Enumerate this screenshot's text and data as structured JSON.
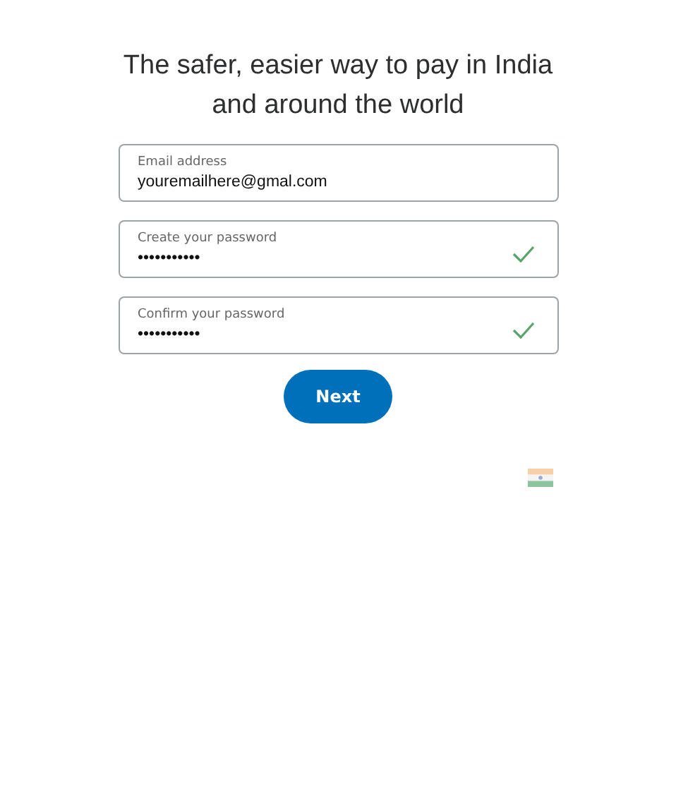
{
  "heading": "The safer, easier way to pay in India and around the world",
  "fields": [
    {
      "label": "Email address",
      "value": "youremailhere@gmal.com",
      "valid": false
    },
    {
      "label": "Create your password",
      "value": "•••••••••••",
      "valid": true
    },
    {
      "label": "Confirm your password",
      "value": "•••••••••••",
      "valid": true
    }
  ],
  "button": "Next"
}
